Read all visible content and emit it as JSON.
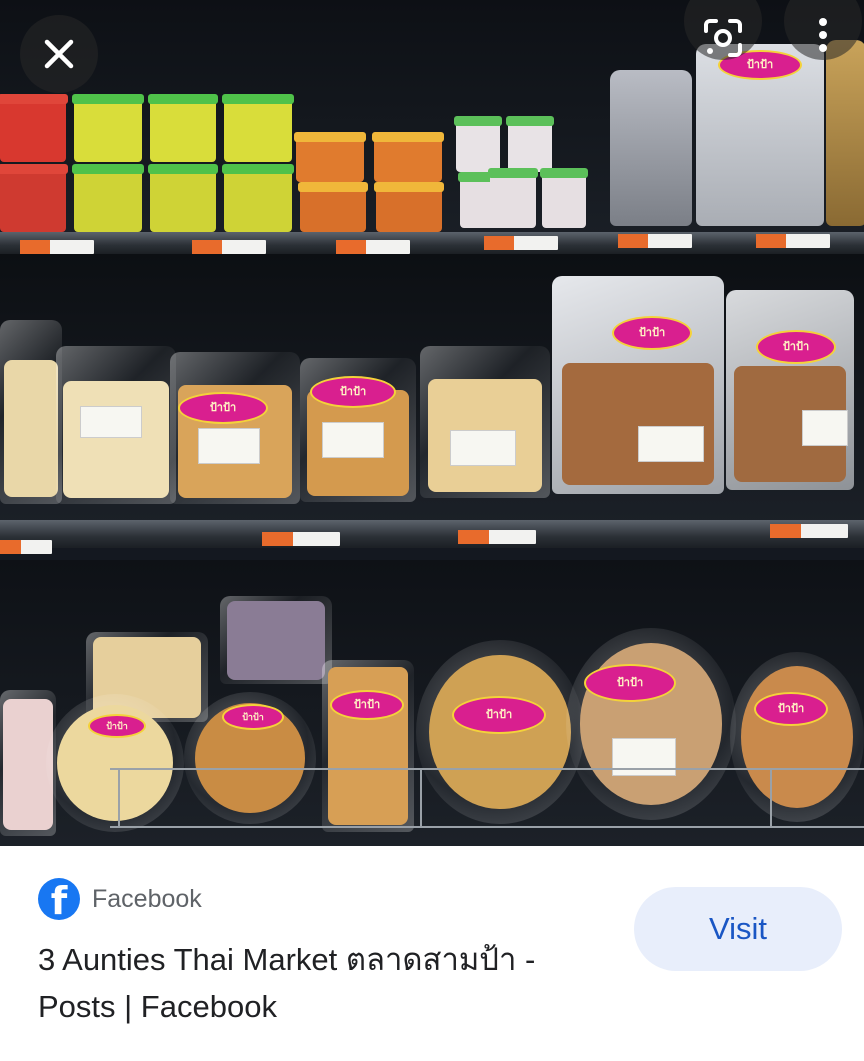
{
  "viewer": {
    "close_icon": "close-icon",
    "lens_icon": "google-lens-icon",
    "more_icon": "more-vert-icon"
  },
  "photo": {
    "shelf_logo_text": "ป้าป้า",
    "colors": {
      "logo_magenta": "#d91f8f",
      "logo_yellow": "#f4d23a",
      "price_orange": "#e86b2c"
    }
  },
  "result": {
    "source": {
      "name": "Facebook",
      "icon": "facebook-icon",
      "color": "#1877f2"
    },
    "title_line1": "3 Aunties Thai Market ตลาดสามป้า -",
    "title_line2": "Posts | Facebook",
    "visit_label": "Visit",
    "snippet": ""
  }
}
